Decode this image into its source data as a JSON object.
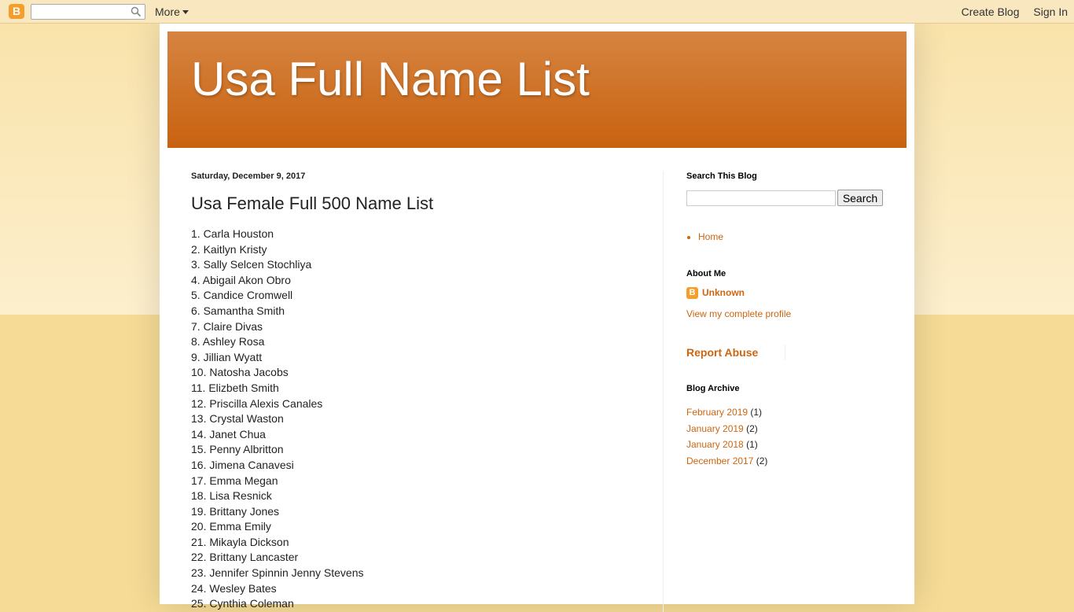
{
  "navbar": {
    "logo_letter": "B",
    "search_placeholder": "",
    "more_label": "More",
    "create_blog": "Create Blog",
    "sign_in": "Sign In"
  },
  "blog": {
    "title": "Usa Full Name List"
  },
  "post": {
    "date": "Saturday, December 9, 2017",
    "title": "Usa Female Full 500 Name List",
    "names": [
      "1. Carla Houston",
      "2. Kaitlyn Kristy",
      "3. Sally Selcen Stochliya",
      "4. Abigail Akon Obro",
      "5. Candice Cromwell",
      "6. Samantha Smith",
      "7. Claire Divas",
      "8. Ashley Rosa",
      "9. Jillian Wyatt",
      "10. Natosha Jacobs",
      "11. Elizbeth Smith",
      "12. Priscilla Alexis Canales",
      "13. Crystal Waston",
      "14. Janet Chua",
      "15. Penny Albritton",
      "16. Jimena Canavesi",
      "17. Emma Megan",
      "18. Lisa Resnick",
      "19. Brittany Jones",
      "20. Emma Emily",
      "21. Mikayla Dickson",
      "22. Brittany Lancaster",
      "23. Jennifer Spinnin Jenny Stevens",
      "24. Wesley Bates",
      "25. Cynthia Coleman"
    ]
  },
  "sidebar": {
    "search_title": "Search This Blog",
    "search_button": "Search",
    "pages": [
      "Home"
    ],
    "about_title": "About Me",
    "profile_name": "Unknown",
    "view_profile": "View my complete profile",
    "report_abuse": "Report Abuse",
    "archive_title": "Blog Archive",
    "archive": [
      {
        "label": "February 2019",
        "count": "(1)"
      },
      {
        "label": "January 2019",
        "count": "(2)"
      },
      {
        "label": "January 2018",
        "count": "(1)"
      },
      {
        "label": "December 2017",
        "count": "(2)"
      }
    ]
  },
  "colors": {
    "header_top": "#d68441",
    "header_bottom": "#c8620f",
    "link": "#cc6611",
    "background": "#f6db96"
  }
}
